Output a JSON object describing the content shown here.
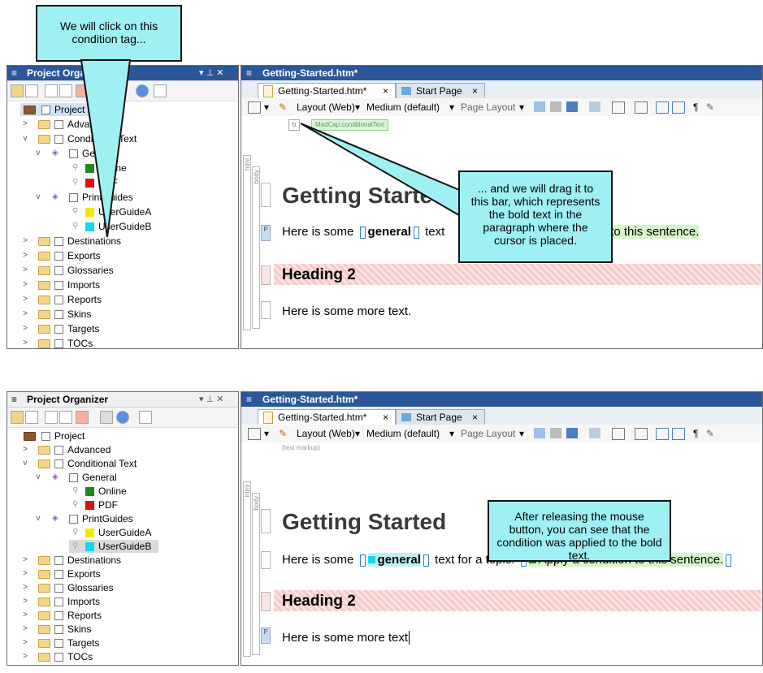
{
  "top": {
    "callout_click": "We will click on this condition tag...",
    "callout_drag": "... and we will drag it to this bar, which represents the bold text in the paragraph where the cursor is placed.",
    "project_organizer": {
      "title": "Project Organizer",
      "pin": "▾ ⊥ ✕",
      "tree": [
        {
          "label": "Project",
          "level": 0,
          "arrow": ""
        },
        {
          "label": "Advanced",
          "level": 1,
          "arrow": ">"
        },
        {
          "label": "Conditional Text",
          "level": 1,
          "arrow": "v"
        },
        {
          "label": "General",
          "level": 2,
          "arrow": "v"
        },
        {
          "label": "Online",
          "level": 3,
          "arrow": ""
        },
        {
          "label": "PDF",
          "level": 3,
          "arrow": ""
        },
        {
          "label": "PrintGuides",
          "level": 2,
          "arrow": "v"
        },
        {
          "label": "UserGuideA",
          "level": 3,
          "arrow": ""
        },
        {
          "label": "UserGuideB",
          "level": 3,
          "arrow": ""
        },
        {
          "label": "Destinations",
          "level": 1,
          "arrow": ">"
        },
        {
          "label": "Exports",
          "level": 1,
          "arrow": ">"
        },
        {
          "label": "Glossaries",
          "level": 1,
          "arrow": ">"
        },
        {
          "label": "Imports",
          "level": 1,
          "arrow": ">"
        },
        {
          "label": "Reports",
          "level": 1,
          "arrow": ">"
        },
        {
          "label": "Skins",
          "level": 1,
          "arrow": ">"
        },
        {
          "label": "Targets",
          "level": 1,
          "arrow": ">"
        },
        {
          "label": "TOCs",
          "level": 1,
          "arrow": ">"
        }
      ]
    },
    "editor": {
      "window_title": "Getting-Started.htm*",
      "tab_active": "Getting-Started.htm*",
      "tab_inactive": "Start Page",
      "tab_close": "×",
      "layout": "Layout (Web)",
      "medium": "Medium (default)",
      "page_layout": "Page Layout",
      "markup_tag": "MadCap:conditionalText",
      "markup_b": "b",
      "heading1": "Getting Started",
      "para1_pre": "Here is some",
      "para1_bold": "general",
      "para1_post": "text",
      "para1_end": "...ition to this sentence.",
      "heading2": "Heading 2",
      "para2": "Here is some more text."
    }
  },
  "bottom": {
    "callout": "After releasing the mouse button, you can see that the condition was applied to the bold text.",
    "project_organizer": {
      "title": "Project Organizer",
      "pin": "▾ ⊥ ✕"
    },
    "editor": {
      "window_title": "Getting-Started.htm*",
      "tab_active": "Getting-Started.htm*",
      "tab_inactive": "Start Page",
      "tab_close": "×",
      "layout": "Layout (Web)",
      "medium": "Medium (default)",
      "page_layout": "Page Layout",
      "markup_hint": "(text markup)",
      "heading1": "Getting Started",
      "para1_pre": "Here is some",
      "para1_bold": "general",
      "para1_post": "text for a topic.",
      "para1_cond": "Apply a condition to this sentence.",
      "heading2": "Heading 2",
      "para2": "Here is some more text"
    }
  },
  "colors": {
    "online": "#1a8a1a",
    "pdf": "#e01010",
    "userguidea": "#f5e800",
    "userguideb": "#10d8e8",
    "callout": "#9ef0f2",
    "title_bar": "#2b579a"
  }
}
